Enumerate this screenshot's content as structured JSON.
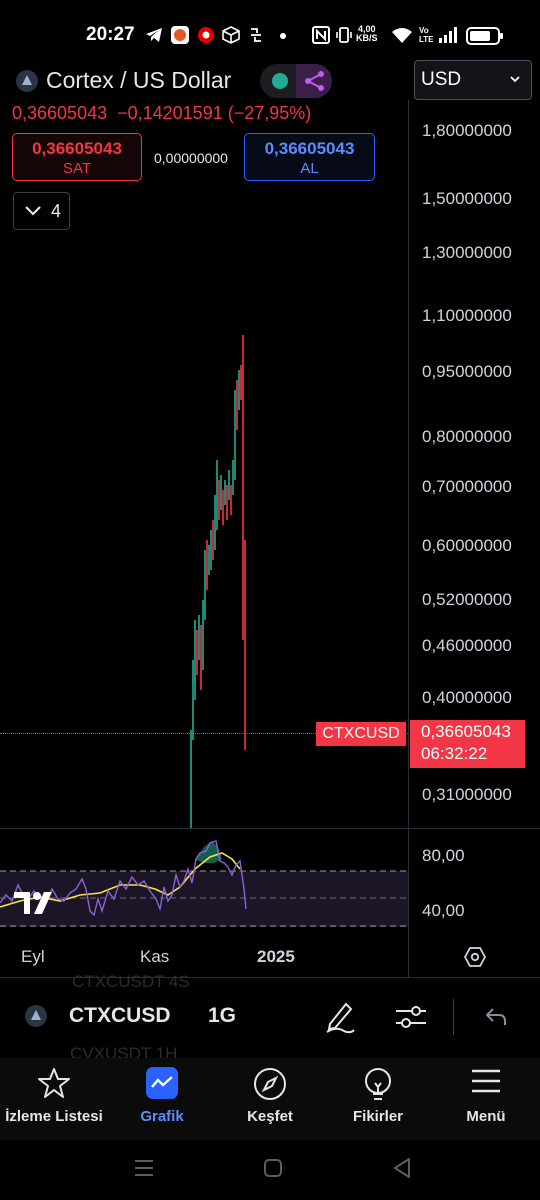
{
  "status_bar": {
    "time": "20:27",
    "net_speed_value": "4,00",
    "net_speed_unit": "KB/S",
    "lte_top": "Vo",
    "lte_bottom": "LTE",
    "icons": [
      "telegram-icon",
      "game-icon",
      "vodafone-icon",
      "box-icon",
      "sync-icon",
      "dot-icon",
      "nfc-icon",
      "vibrate-icon",
      "wifi-icon",
      "signal-icon",
      "battery-icon"
    ]
  },
  "header": {
    "title": "Cortex / US Dollar",
    "currency": "USD",
    "price_change_line": "0,36605043  −0,14201591 (−27,95%)",
    "market_status_color": "#22ab94"
  },
  "trade": {
    "sell_price": "0,36605043",
    "sell_label": "SAT",
    "spread": "0,00000000",
    "buy_price": "0,36605043",
    "buy_label": "AL",
    "collapse_count": "4"
  },
  "price_axis": {
    "scale": "log",
    "ticks": [
      "1,80000000",
      "1,50000000",
      "1,30000000",
      "1,10000000",
      "0,95000000",
      "0,80000000",
      "0,70000000",
      "0,60000000",
      "0,52000000",
      "0,46000000",
      "0,40000000",
      "0,31000000"
    ],
    "last_price_symbol": "CTXCUSD",
    "last_price": "0,36605043",
    "countdown": "06:32:22"
  },
  "rsi": {
    "ticks": [
      "80,00",
      "40,00"
    ]
  },
  "time_axis": {
    "ticks": [
      "Eyl",
      "Kas",
      "2025"
    ]
  },
  "toolbar": {
    "symbol": "CTXCUSD",
    "interval": "1G",
    "ghost_row_1": "CTXCUSDT  4S",
    "ghost_row_2": "CVXUSDT  1H"
  },
  "nav": {
    "items": [
      {
        "label": "İzleme Listesi",
        "icon": "star-icon"
      },
      {
        "label": "Grafik",
        "icon": "chart-icon"
      },
      {
        "label": "Keşfet",
        "icon": "compass-icon"
      },
      {
        "label": "Fikirler",
        "icon": "lightbulb-icon"
      },
      {
        "label": "Menü",
        "icon": "menu-icon"
      }
    ]
  },
  "colors": {
    "up": "#22ab94",
    "down": "#f23645",
    "accent": "#2962ff",
    "rsi_line": "#7e57c2",
    "rsi_ma": "#f5e642"
  }
}
